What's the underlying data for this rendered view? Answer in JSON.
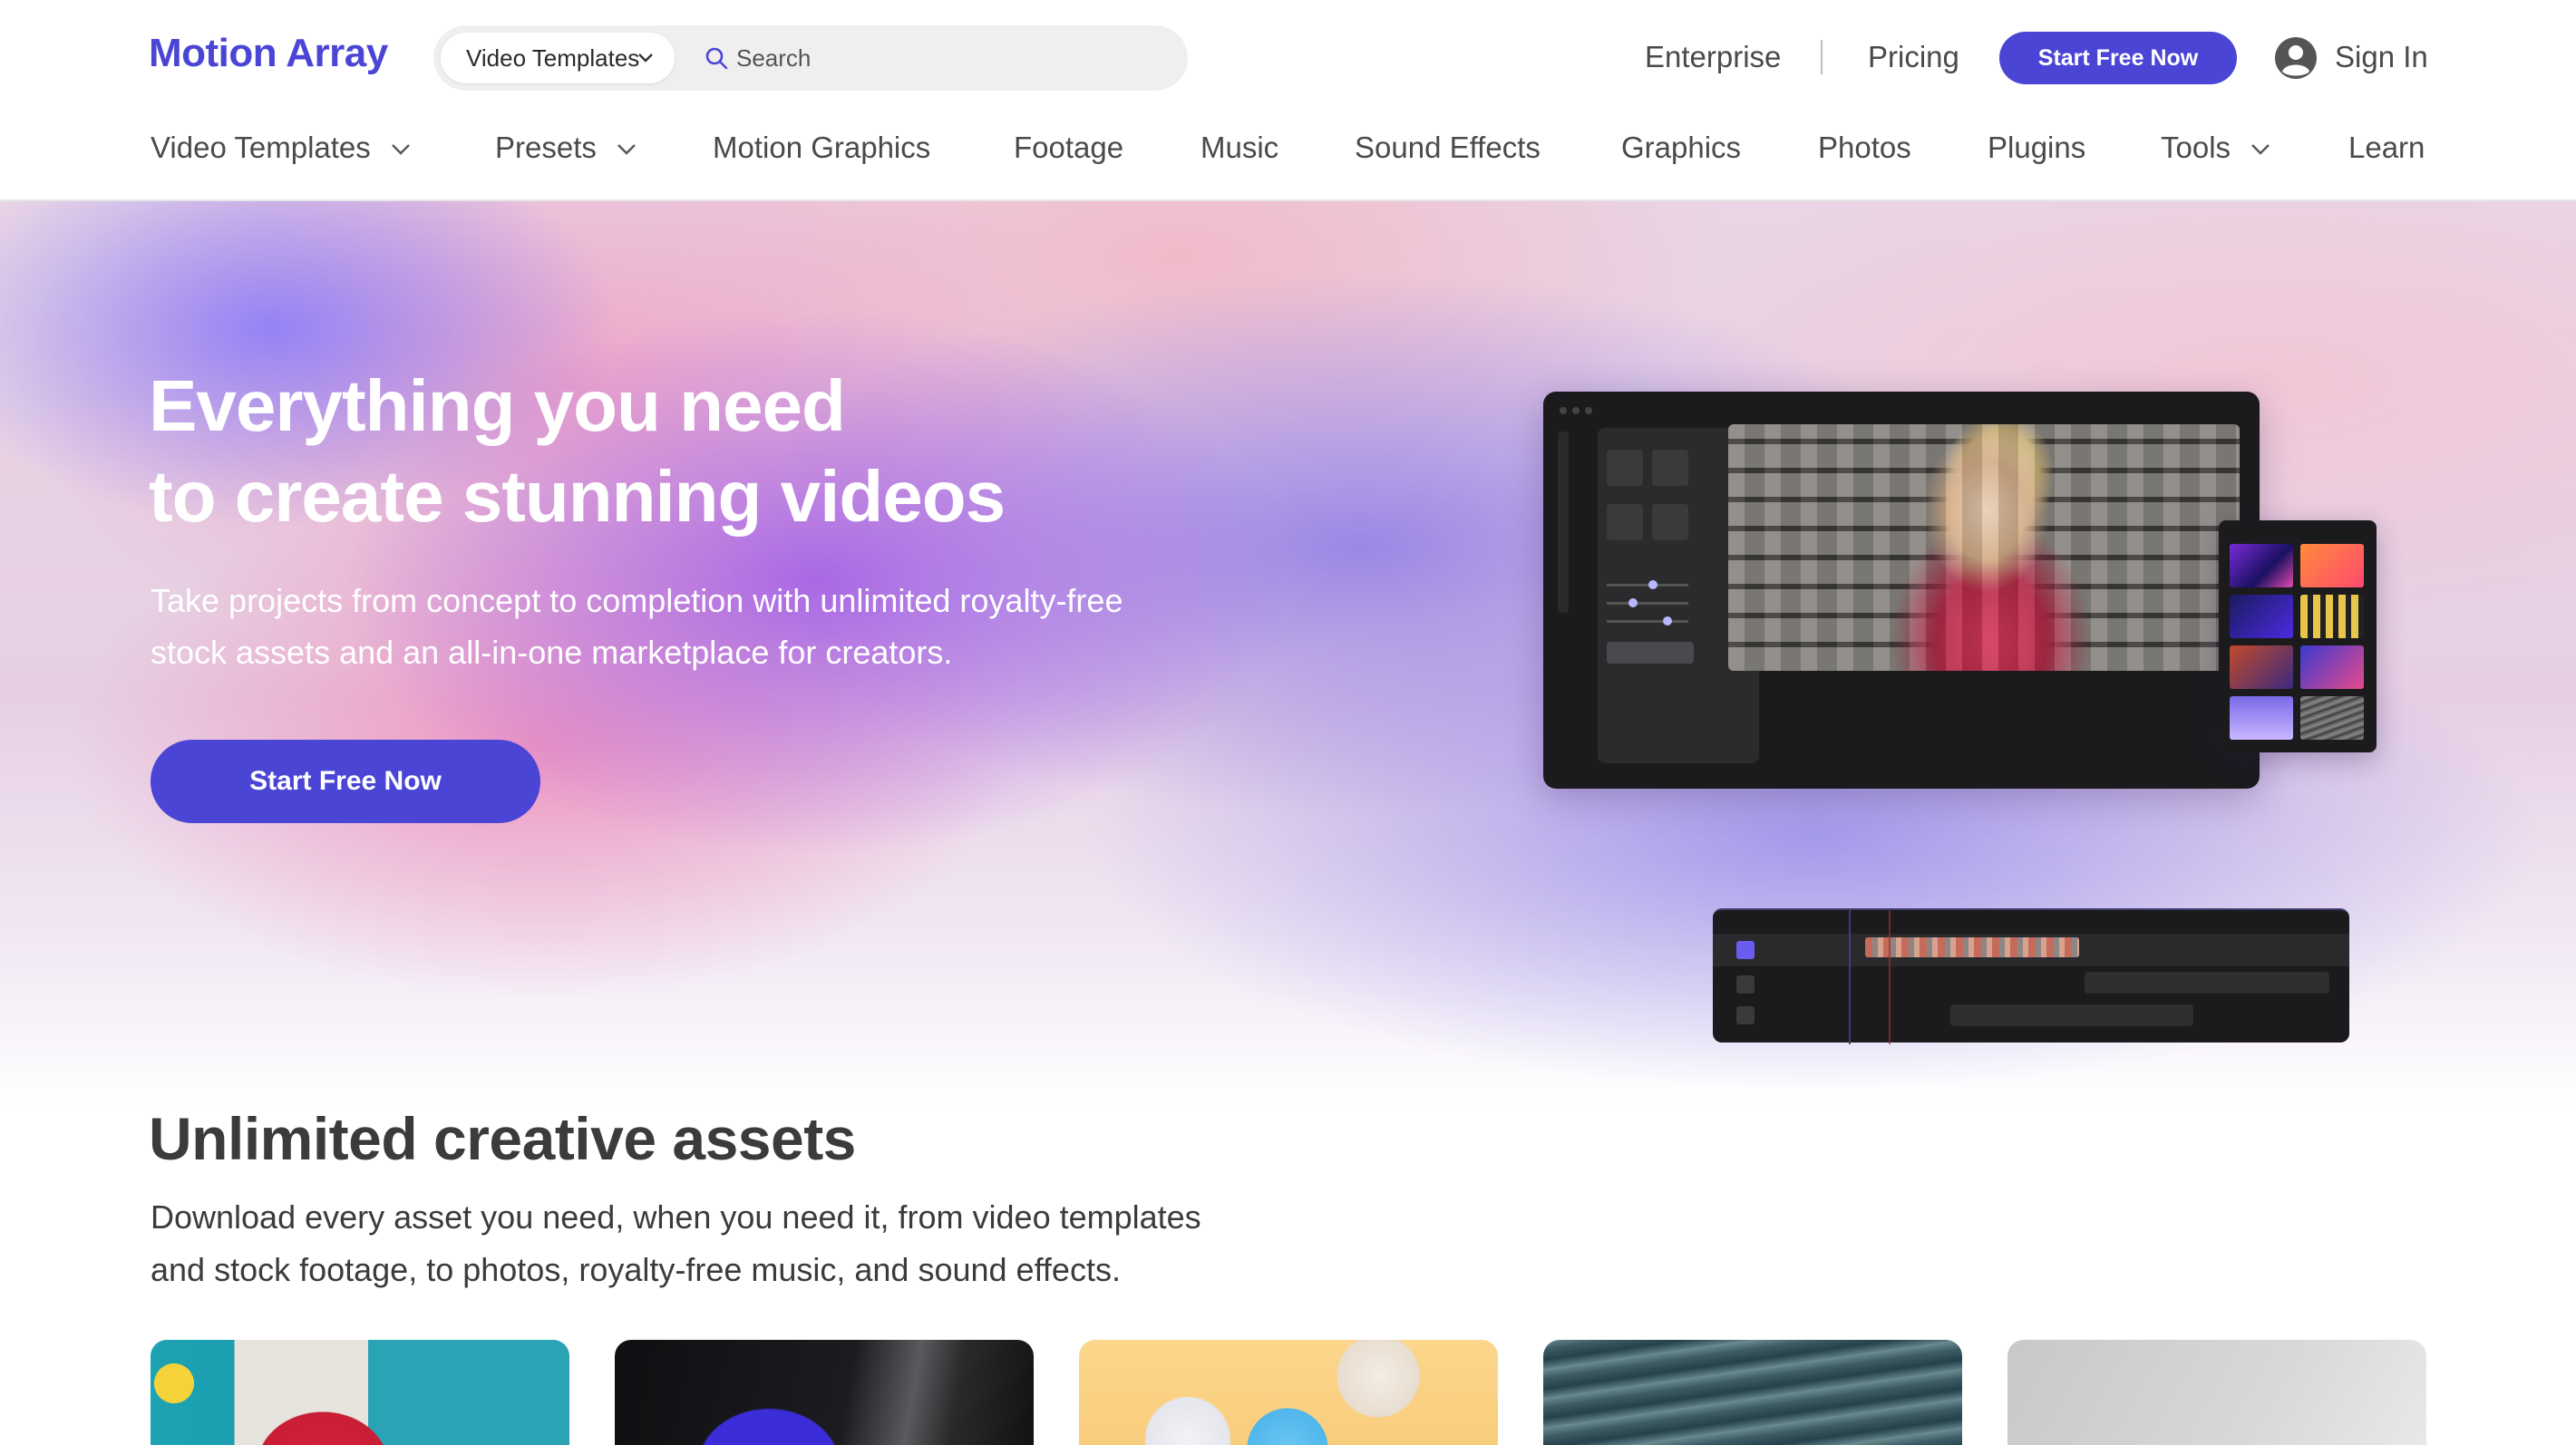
{
  "brand": {
    "name": "Motion Array",
    "accent": "#4b45d6"
  },
  "search": {
    "type_selected": "Video Templates",
    "placeholder": "Search"
  },
  "topnav": {
    "enterprise": "Enterprise",
    "pricing": "Pricing",
    "cta": "Start Free Now",
    "signin": "Sign In"
  },
  "categories": [
    {
      "label": "Video Templates",
      "dropdown": true
    },
    {
      "label": "Presets",
      "dropdown": true
    },
    {
      "label": "Motion Graphics",
      "dropdown": false
    },
    {
      "label": "Footage",
      "dropdown": false
    },
    {
      "label": "Music",
      "dropdown": false
    },
    {
      "label": "Sound Effects",
      "dropdown": false
    },
    {
      "label": "Graphics",
      "dropdown": false
    },
    {
      "label": "Photos",
      "dropdown": false
    },
    {
      "label": "Plugins",
      "dropdown": false
    },
    {
      "label": "Tools",
      "dropdown": true
    },
    {
      "label": "Learn",
      "dropdown": false
    }
  ],
  "hero": {
    "title_line1": "Everything you need",
    "title_line2": "to create stunning videos",
    "subtitle_line1": "Take projects from concept to completion with unlimited royalty-free",
    "subtitle_line2": "stock assets and an all-in-one marketplace for creators.",
    "cta": "Start Free Now"
  },
  "assets": {
    "title": "Unlimited creative assets",
    "subtitle_line1": "Download every asset you need, when you need it, from video templates",
    "subtitle_line2": "and stock footage, to photos, royalty-free music, and sound effects."
  }
}
